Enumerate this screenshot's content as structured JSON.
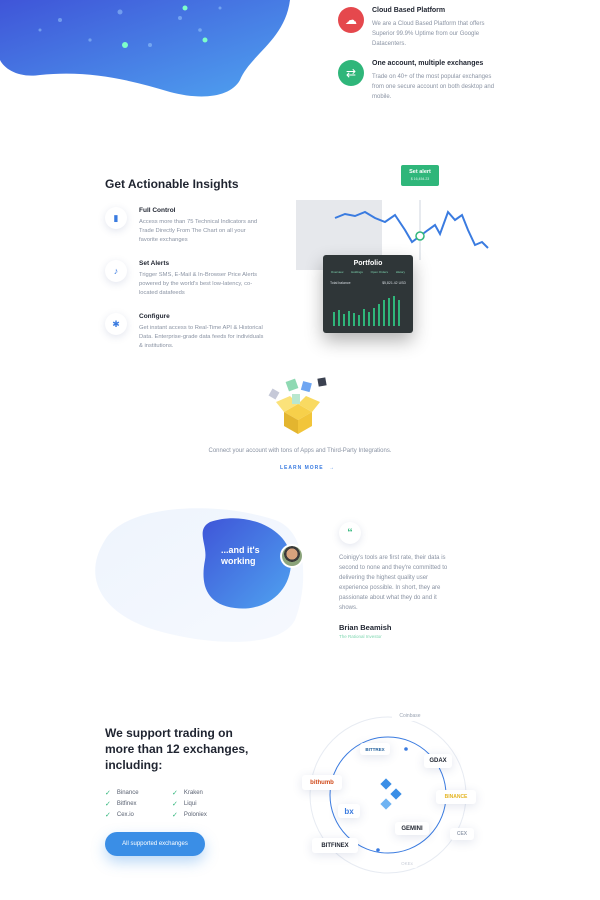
{
  "features": [
    {
      "title": "Cloud Based Platform",
      "text": "We are a Cloud Based Platform that offers Superior 99.9% Uptime from our Google Datacenters.",
      "icon": "cloud-icon",
      "color": "#e5484d"
    },
    {
      "title": "One account, multiple exchanges",
      "text": "Trade on 40+ of the most popular exchanges from one secure account on both desktop and mobile.",
      "icon": "exchange-icon",
      "color": "#2fb67a"
    }
  ],
  "insights": {
    "title": "Get Actionable Insights",
    "items": [
      {
        "title": "Full Control",
        "text": "Access more than 75 Technical Indicators and Trade Directly From The Chart on all your favorite exchanges",
        "icon": "bar-chart-icon"
      },
      {
        "title": "Set Alerts",
        "text": "Trigger SMS, E-Mail & In-Browser Price Alerts powered by the world's best low-latency, co-located datafeeds",
        "icon": "bell-icon"
      },
      {
        "title": "Configure",
        "text": "Get instant access to Real-Time API & Historical Data. Enterprise-grade data feeds for individuals & institutions.",
        "icon": "gear-icon"
      }
    ],
    "set_alert": {
      "label": "Set alert",
      "value": "$ 16,454.23"
    },
    "portfolio": {
      "title": "Portfolio",
      "tabs": [
        "Overview",
        "Holdings",
        "Open Orders",
        "History"
      ],
      "balance_label": "Total balance",
      "balance_value": "$5,821.42 USD"
    }
  },
  "integrations": {
    "text": "Connect your account with tons of Apps and Third-Party Integrations.",
    "link": "LEARN MORE"
  },
  "testimonial": {
    "badge": "...and it's working",
    "quote": "Coinigy's tools are first rate, their data is second to none and they're committed to delivering the highest quality user experience possible. In short, they are passionate about what they do and it shows.",
    "quote_mark": "“",
    "author": "Brian Beamish",
    "org": "The Rational Investor"
  },
  "exchanges": {
    "title": "We support trading on more than 12 exchanges, including:",
    "left": [
      "Binance",
      "Bitfinex",
      "Cex.io"
    ],
    "right": [
      "Kraken",
      "Liqui",
      "Poloniex"
    ],
    "button": "All supported exchanges",
    "logos": [
      "Coinbase",
      "BITTREX",
      "GDAX",
      "bithumb",
      "BINANCE",
      "bx",
      "GEMINI",
      "CEX",
      "BITFINEX",
      "OKEx"
    ]
  },
  "colors": {
    "accent": "#3a7be0",
    "green": "#2fb67a",
    "red": "#e5484d"
  }
}
